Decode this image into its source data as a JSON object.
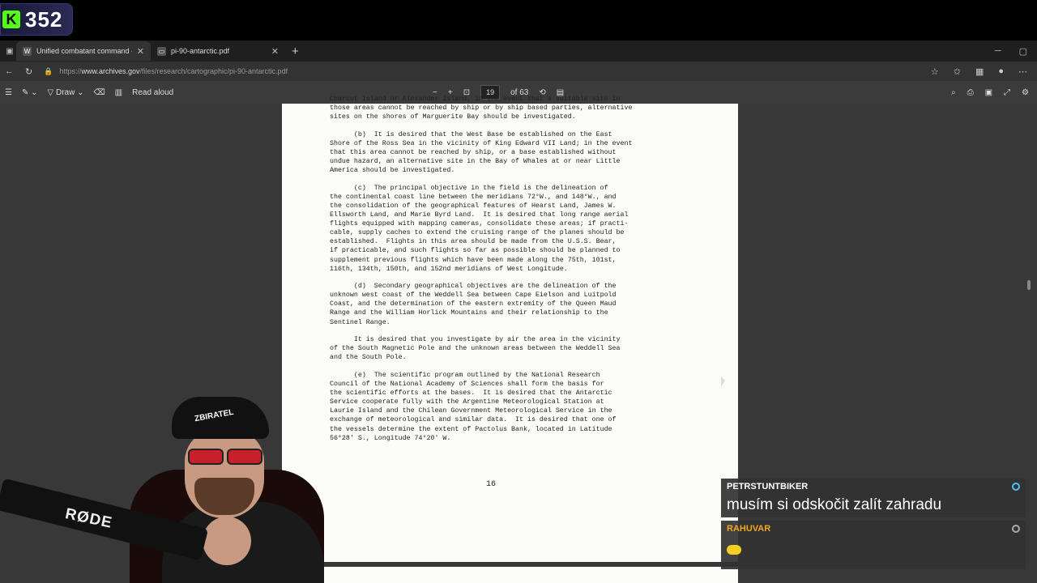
{
  "stream": {
    "viewer_count": "352",
    "kick_letter": "K"
  },
  "tabs": [
    {
      "title": "Unified combatant command - W",
      "favicon": "W"
    },
    {
      "title": "pi-90-antarctic.pdf",
      "favicon": "pdf-icon"
    }
  ],
  "address": {
    "prefix": "https://",
    "host": "www.archives.gov",
    "path": "/files/research/cartographic/pi-90-antarctic.pdf"
  },
  "pdf_toolbar": {
    "draw_label": "Draw",
    "read_aloud_label": "Read aloud",
    "current_page": "19",
    "total_pages": "of 63"
  },
  "document": {
    "paragraphs": [
      "Charcot Island or Alexander Island, in the event that a suitable site in\nthose areas cannot be reached by ship or by ship based parties, alternative\nsites on the shores of Marguerite Bay should be investigated.",
      "      (b)  It is desired that the West Base be established on the East\nShore of the Ross Sea in the vicinity of King Edward VII Land; in the event\nthat this area cannot be reached by ship, or a base established without\nundue hazard, an alternative site in the Bay of Whales at or near Little\nAmerica should be investigated.",
      "      (c)  The principal objective in the field is the delineation of\nthe continental coast line between the meridians 72°W., and 148°W., and\nthe consolidation of the geographical features of Hearst Land, James W.\nEllsworth Land, and Marie Byrd Land.  It is desired that long range aerial\nflights equipped with mapping cameras, consolidate these areas; if practi-\ncable, supply caches to extend the cruising range of the planes should be\nestablished.  Flights in this area should be made from the U.S.S. Bear,\nif practicable, and such flights so far as possible should be planned to\nsupplement previous flights which have been made along the 75th, 101st,\n116th, 134th, 150th, and 152nd meridians of West Longitude.",
      "      (d)  Secondary geographical objectives are the delineation of the\nunknown west coast of the Weddell Sea between Cape Eielson and Luitpold\nCoast, and the determination of the eastern extremity of the Queen Maud\nRange and the William Horlick Mountains and their relationship to the\nSentinel Range.",
      "      It is desired that you investigate by air the area in the vicinity\nof the South Magnetic Pole and the unknown areas between the Weddell Sea\nand the South Pole.",
      "      (e)  The scientific program outlined by the National Research\nCouncil of the National Academy of Sciences shall form the basis for\nthe scientific efforts at the bases.  It is desired that the Antarctic\nService cooperate fully with the Argentine Meteorological Station at\nLaurie Island and the Chilean Government Meteorological Service in the\nexchange of meteorological and similar data.  It is desired that one of\nthe vessels determine the extent of Pactolus Bank, located in Latitude\n56°28' S., Longitude 74°20' W."
    ],
    "page_number": "16"
  },
  "webcam": {
    "mic_brand": "RØDE",
    "cap_text": "ZBIRATEL"
  },
  "chat": [
    {
      "user": "PETRSTUNTBIKER",
      "message": "musím si odskočit zalít zahradu"
    },
    {
      "user": "RAHUVAR",
      "message": ""
    }
  ],
  "colors": {
    "kick_green": "#53fc18",
    "chat_user2": "#f5a623",
    "lens_red": "#c8202a"
  }
}
